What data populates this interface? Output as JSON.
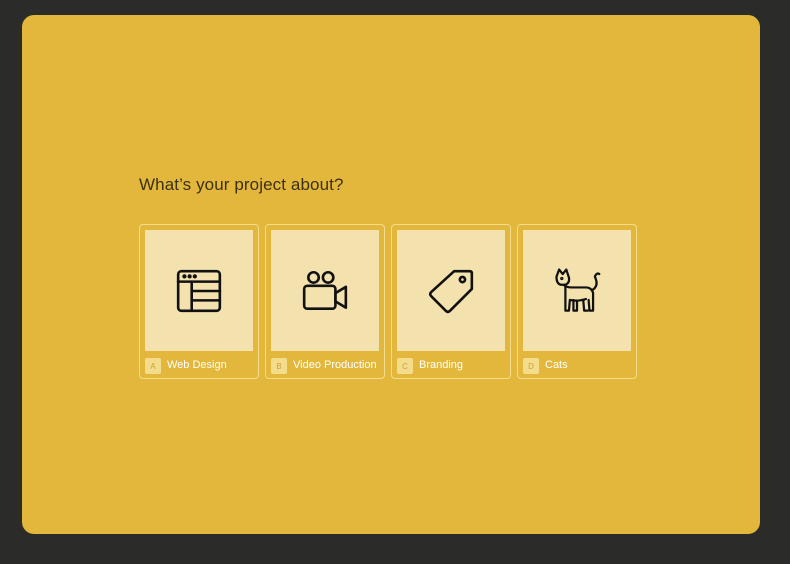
{
  "form": {
    "question": "What’s your project about?",
    "choices": [
      {
        "key": "A",
        "label": "Web Design",
        "icon": "browser-window-icon"
      },
      {
        "key": "B",
        "label": "Video Production",
        "icon": "video-camera-icon"
      },
      {
        "key": "C",
        "label": "Branding",
        "icon": "price-tag-icon"
      },
      {
        "key": "D",
        "label": "Cats",
        "icon": "cat-icon"
      }
    ]
  },
  "colors": {
    "page_background": "#2b2b29",
    "card_background": "#e3b73b",
    "choice_border": "#f3dc8c",
    "choice_thumb": "#f3e2ae",
    "question_text": "#3d3114",
    "label_text": "#ffffff"
  }
}
